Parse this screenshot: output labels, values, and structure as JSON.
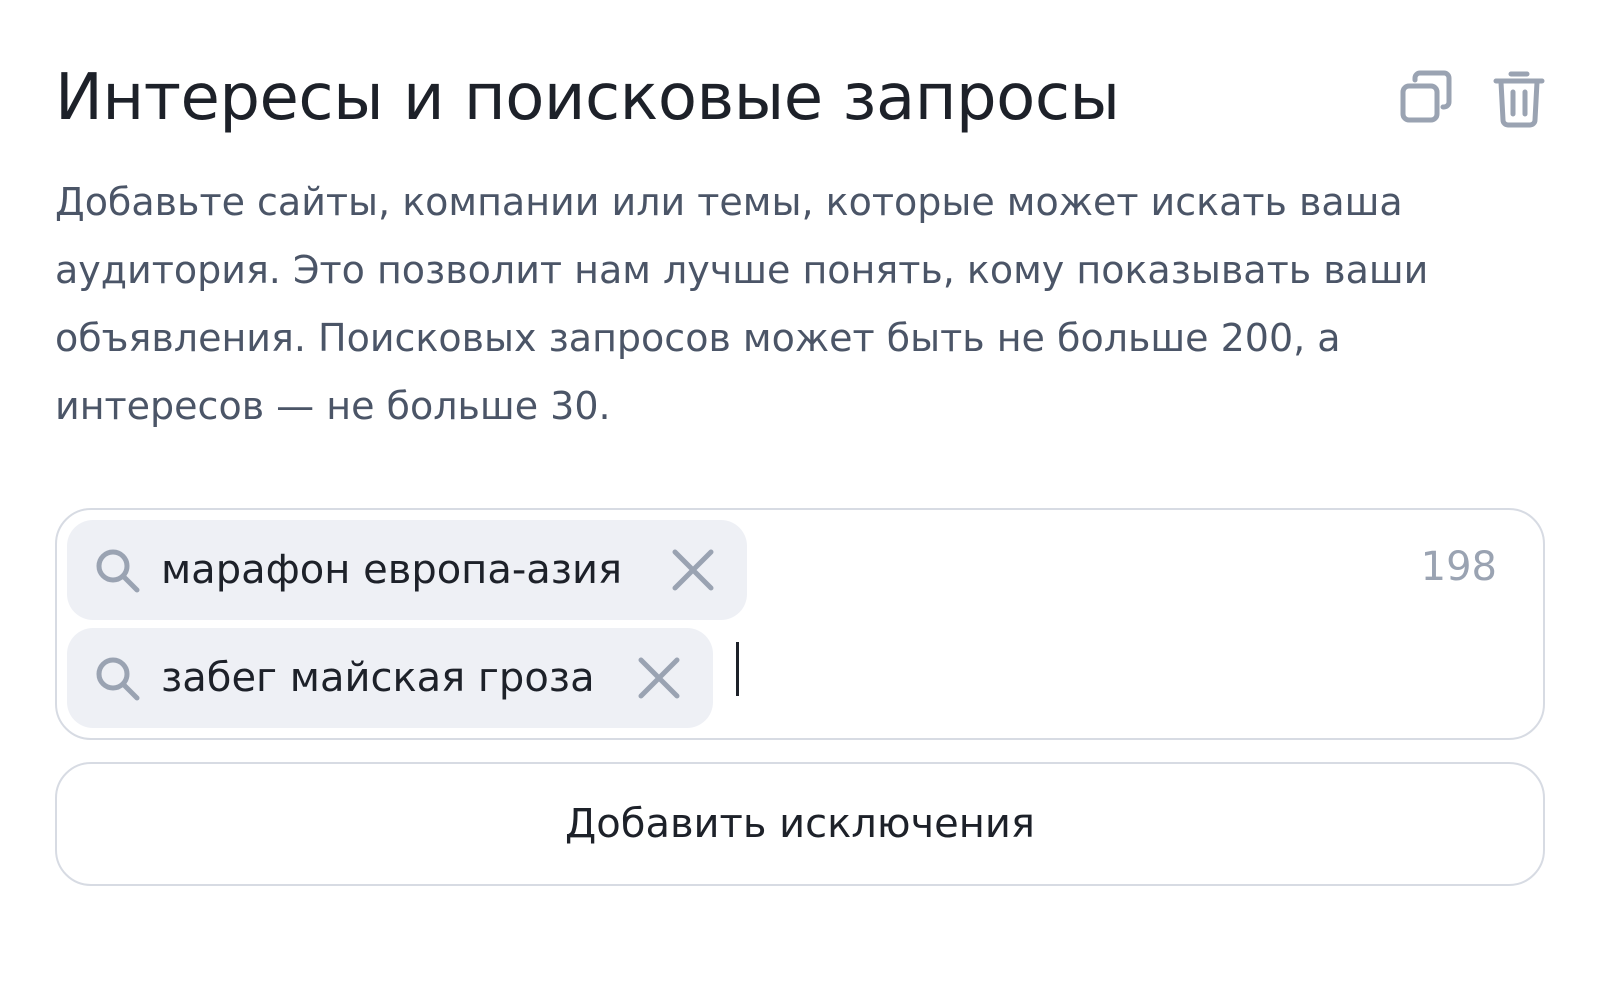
{
  "section": {
    "title": "Интересы и поисковые запросы",
    "description": "Добавьте сайты, компании или темы, которые может искать ваша аудитория. Это позволит нам лучше понять, кому показывать ваши объявления. Поисковых запросов может быть не больше 200, а интересов — не больше 30."
  },
  "header_actions": {
    "copy_icon": "copy-icon",
    "delete_icon": "trash-icon"
  },
  "tags_field": {
    "counter": "198",
    "input_value": "",
    "tags": [
      {
        "label": "марафон европа-азия",
        "icon": "search-icon",
        "remove_icon": "close-icon"
      },
      {
        "label": "забег майская гроза",
        "icon": "search-icon",
        "remove_icon": "close-icon"
      }
    ]
  },
  "add_exclusions_button": {
    "label": "Добавить исключения"
  },
  "colors": {
    "text_primary": "#1d2129",
    "text_secondary": "#4b5567",
    "icon_muted": "#9aa3b2",
    "tag_background": "#eef0f5",
    "border": "#d7dbe3"
  }
}
